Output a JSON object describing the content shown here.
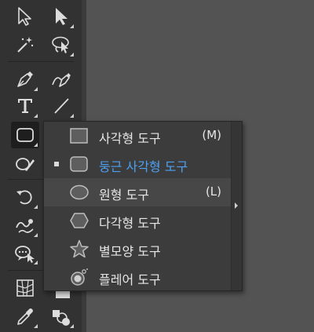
{
  "toolbar": {
    "tools": [
      {
        "name": "selection-tool-icon"
      },
      {
        "name": "direct-selection-tool-icon"
      },
      {
        "name": "magic-wand-tool-icon"
      },
      {
        "name": "lasso-tool-icon"
      },
      {
        "name": "pen-tool-icon"
      },
      {
        "name": "curvature-tool-icon"
      },
      {
        "name": "type-tool-icon"
      },
      {
        "name": "line-segment-tool-icon"
      },
      {
        "name": "rectangle-tool-icon"
      },
      {
        "name": "shaper-tool-icon"
      },
      {
        "name": "rotate-tool-icon"
      },
      {
        "name": "warp-tool-icon"
      },
      {
        "name": "free-transform-tool-icon"
      },
      {
        "name": "perspective-grid-tool-icon"
      },
      {
        "name": "eyedropper-tool-icon"
      },
      {
        "name": "shape-builder-tool-icon"
      }
    ]
  },
  "flyout": {
    "items": [
      {
        "label": "사각형 도구",
        "shortcut": "(M)",
        "icon": "rectangle-icon",
        "selected": false
      },
      {
        "label": "둥근 사각형 도구",
        "shortcut": "",
        "icon": "rounded-rectangle-icon",
        "selected": true
      },
      {
        "label": "원형 도구",
        "shortcut": "(L)",
        "icon": "ellipse-icon",
        "selected": false
      },
      {
        "label": "다각형 도구",
        "shortcut": "",
        "icon": "polygon-icon",
        "selected": false
      },
      {
        "label": "별모양 도구",
        "shortcut": "",
        "icon": "star-icon",
        "selected": false
      },
      {
        "label": "플레어 도구",
        "shortcut": "",
        "icon": "flare-icon",
        "selected": false
      }
    ]
  },
  "colors": {
    "selected_text": "#4da0f0",
    "menu_bg": "#3c3c3c",
    "toolbar_bg": "#323232",
    "canvas_bg": "#535353"
  }
}
